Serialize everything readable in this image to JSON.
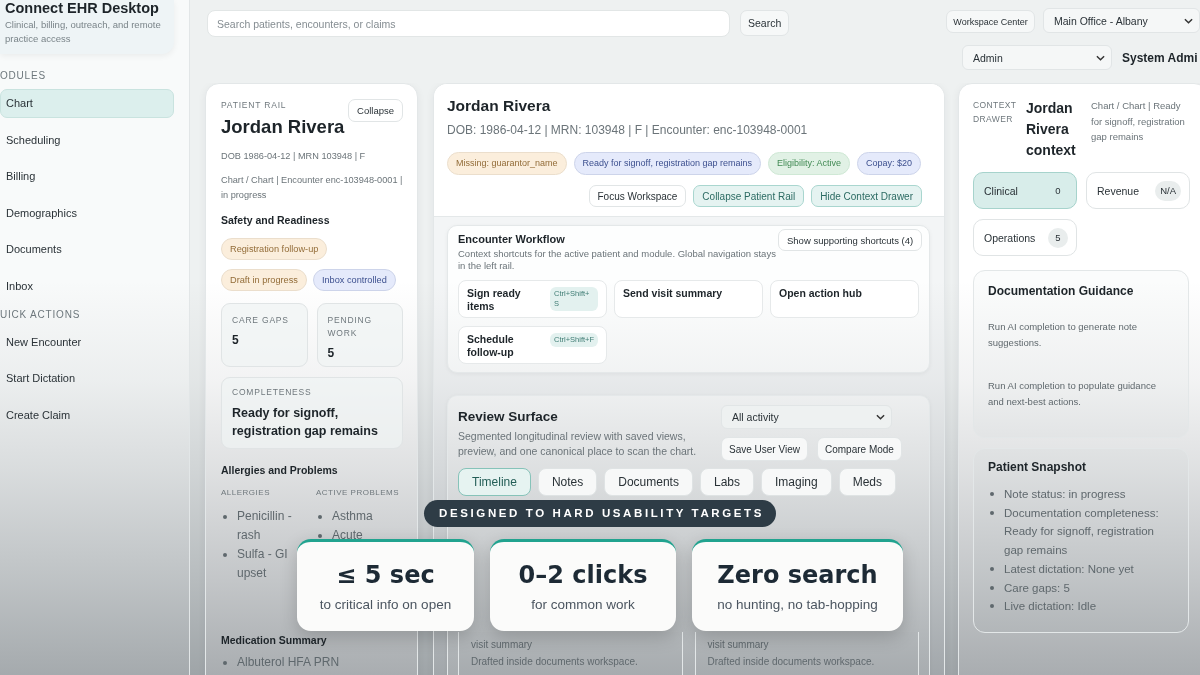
{
  "sidebar": {
    "brand": {
      "title": "Connect EHR Desktop",
      "subtitle": "Clinical, billing, outreach, and remote practice access"
    },
    "sections": [
      {
        "heading": "ODULES",
        "items": [
          {
            "label": "Chart",
            "selected": true
          },
          {
            "label": "Scheduling",
            "selected": false
          },
          {
            "label": "Billing",
            "selected": false
          },
          {
            "label": "Demographics",
            "selected": false
          },
          {
            "label": "Documents",
            "selected": false
          },
          {
            "label": "Inbox",
            "selected": false
          }
        ]
      },
      {
        "heading": "UICK ACTIONS",
        "items": [
          {
            "label": "New Encounter"
          },
          {
            "label": "Start Dictation"
          },
          {
            "label": "Create Claim"
          }
        ]
      }
    ]
  },
  "topbar": {
    "search": {
      "placeholder": "Search patients, encounters, or claims"
    },
    "search_button": "Search",
    "workspace_button": "Workspace Center",
    "location_select": "Main Office - Albany",
    "role_select": "Admin",
    "user_name": "System Admi"
  },
  "patient_rail": {
    "label": "PATIENT RAIL",
    "collapse_button": "Collapse",
    "name": "Jordan Rivera",
    "identifiers": "DOB 1986-04-12 | MRN 103948 | F",
    "context": "Chart / Chart | Encounter enc-103948-0001 | in progress",
    "safety": {
      "heading": "Safety and Readiness",
      "tags": [
        {
          "label": "Registration follow-up",
          "color": "#fbeedc"
        },
        {
          "label": "Draft in progress",
          "color": "#fbeedc"
        },
        {
          "label": "Inbox controlled",
          "color": "#e5eafb"
        }
      ]
    },
    "stats": [
      {
        "label": "CARE GAPS",
        "value": "5"
      },
      {
        "label": "PENDING WORK",
        "value": "5"
      }
    ],
    "completeness": {
      "label": "COMPLETENESS",
      "value": "Ready for signoff, registration gap remains"
    },
    "allergies_problems": {
      "heading": "Allergies and Problems",
      "columns": [
        {
          "heading": "ALLERGIES",
          "items": [
            "Penicillin - rash",
            "Sulfa - GI upset"
          ]
        },
        {
          "heading": "ACTIVE PROBLEMS",
          "items": [
            "Asthma",
            "Acute"
          ]
        }
      ]
    },
    "medications": {
      "heading": "Medication Summary",
      "items": [
        "Albuterol HFA PRN"
      ]
    }
  },
  "encounter": {
    "name": "Jordan Rivera",
    "identifiers": "DOB: 1986-04-12 | MRN: 103948 | F | Encounter: enc-103948-0001",
    "tags": [
      {
        "label": "Missing: guarantor_name",
        "color": "#fbeedc"
      },
      {
        "label": "Ready for signoff, registration gap remains",
        "color": "#e5eafb"
      },
      {
        "label": "Eligibility: Active",
        "color": "#e1f1e5"
      },
      {
        "label": "Copay: $20",
        "color": "#e5eafb"
      }
    ],
    "actions": [
      {
        "label": "Focus Workspace",
        "kind": "plain"
      },
      {
        "label": "Collapse Patient Rail",
        "kind": "accent"
      },
      {
        "label": "Hide Context Drawer",
        "kind": "accent"
      }
    ],
    "workflow": {
      "title": "Encounter Workflow",
      "description": "Context shortcuts for the active patient and module. Global navigation stays in the left rail.",
      "toggle_button": "Show supporting shortcuts (4)",
      "shortcuts": [
        {
          "label": "Sign ready items",
          "keys": "Ctrl+Shift+S"
        },
        {
          "label": "Send visit summary"
        },
        {
          "label": "Open action hub"
        },
        {
          "label": "Schedule follow-up",
          "keys": "Ctrl+Shift+F"
        }
      ]
    },
    "review": {
      "title": "Review Surface",
      "description": "Segmented longitudinal review with saved views, preview, and one canonical place to scan the chart.",
      "filter_select": "All activity",
      "buttons": [
        "Save User View",
        "Compare Mode"
      ],
      "tabs": [
        {
          "label": "Timeline",
          "selected": true
        },
        {
          "label": "Notes",
          "selected": false
        },
        {
          "label": "Documents",
          "selected": false
        },
        {
          "label": "Labs",
          "selected": false
        },
        {
          "label": "Imaging",
          "selected": false
        },
        {
          "label": "Meds",
          "selected": false
        }
      ],
      "documents": [
        {
          "type_line": "visit summary",
          "note": "Drafted inside documents workspace."
        },
        {
          "type_line": "visit summary",
          "note": "Drafted inside documents workspace."
        }
      ]
    }
  },
  "context_drawer": {
    "label": "CONTEXT DRAWER",
    "title": "Jordan Rivera context",
    "summary": "Chart / Chart | Ready for signoff, registration gap remains",
    "tabs": [
      {
        "label": "Clinical",
        "count": "0",
        "selected": true
      },
      {
        "label": "Revenue",
        "count": "N/A",
        "selected": false
      },
      {
        "label": "Operations",
        "count": "5",
        "selected": false
      }
    ],
    "guidance": {
      "title": "Documentation Guidance",
      "paragraphs": [
        "Run AI completion to generate note suggestions.",
        "Run AI completion to populate guidance and next-best actions."
      ]
    },
    "snapshot": {
      "title": "Patient Snapshot",
      "items": [
        "Note status: in progress",
        "Documentation completeness: Ready for signoff, registration gap remains",
        "Latest dictation: None yet",
        "Care gaps: 5",
        "Live dictation: Idle"
      ]
    }
  },
  "overlay": {
    "banner": "DESIGNED TO HARD USABILITY TARGETS",
    "stats": [
      {
        "value": "≤ 5 sec",
        "caption": "to critical info on open"
      },
      {
        "value": "0–2 clicks",
        "caption": "for common work"
      },
      {
        "value": "Zero search",
        "caption": "no hunting, no tab-hopping"
      }
    ]
  }
}
